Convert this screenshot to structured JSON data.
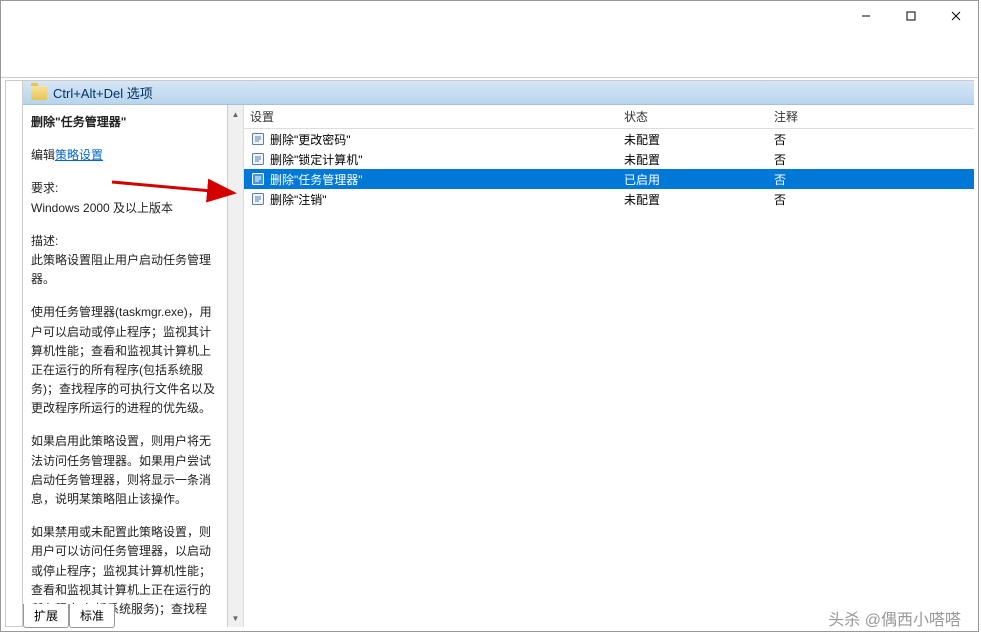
{
  "folder_title": "Ctrl+Alt+Del 选项",
  "description_panel": {
    "title": "删除\"任务管理器\"",
    "edit_prefix": "编辑",
    "edit_link": "策略设置",
    "req_label": "要求:",
    "req_text": "Windows 2000 及以上版本",
    "desc_label": "描述:",
    "desc_1": "此策略设置阻止用户启动任务管理器。",
    "desc_2": "使用任务管理器(taskmgr.exe)，用户可以启动或停止程序；监视其计算机性能；查看和监视其计算机上正在运行的所有程序(包括系统服务)；查找程序的可执行文件名以及更改程序所运行的进程的优先级。",
    "desc_3": "如果启用此策略设置，则用户将无法访问任务管理器。如果用户尝试启动任务管理器，则将显示一条消息，说明某策略阻止该操作。",
    "desc_4": "如果禁用或未配置此策略设置，则用户可以访问任务管理器，以启动或停止程序；监视其计算机性能；查看和监视其计算机上正在运行的所有程序(包括系统服务)；查找程"
  },
  "columns": {
    "setting": "设置",
    "state": "状态",
    "comment": "注释"
  },
  "rows": [
    {
      "label": "删除\"更改密码\"",
      "state": "未配置",
      "comment": "否",
      "selected": false
    },
    {
      "label": "删除\"锁定计算机\"",
      "state": "未配置",
      "comment": "否",
      "selected": false
    },
    {
      "label": "删除\"任务管理器\"",
      "state": "已启用",
      "comment": "否",
      "selected": true
    },
    {
      "label": "删除\"注销\"",
      "state": "未配置",
      "comment": "否",
      "selected": false
    }
  ],
  "tabs": {
    "extended": "扩展",
    "standard": "标准"
  },
  "watermark": "头杀 @偶西小嗒嗒"
}
